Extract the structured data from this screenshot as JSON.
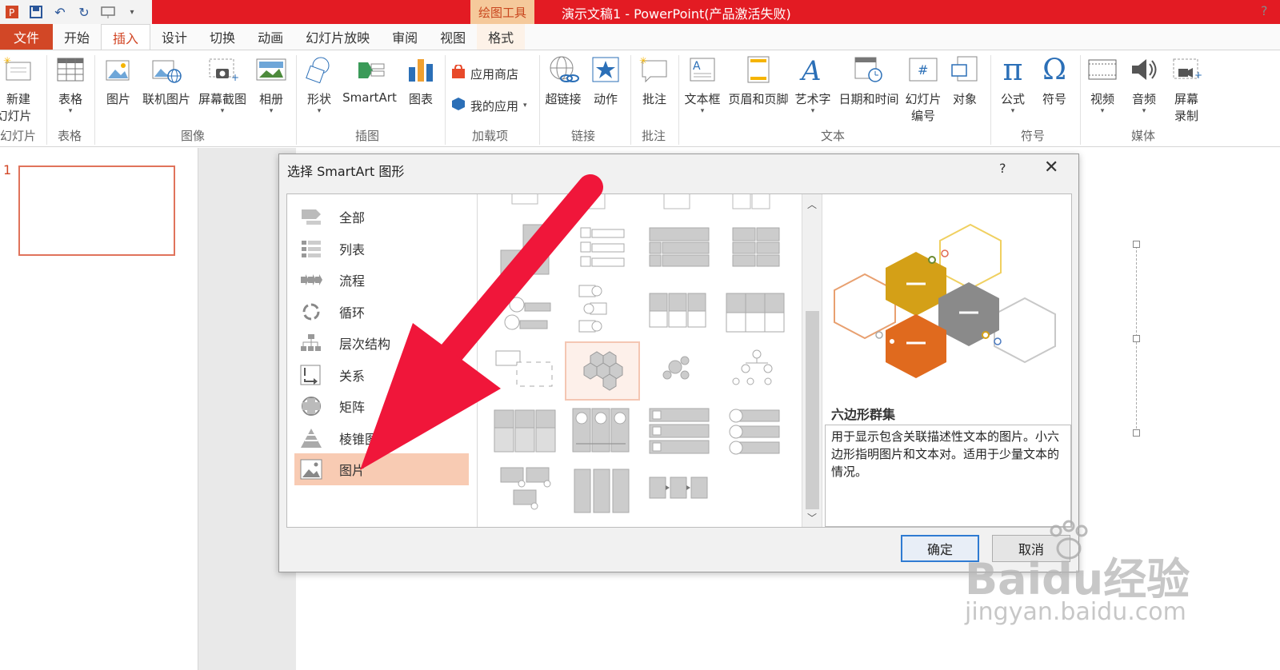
{
  "window": {
    "title": "演示文稿1 -  PowerPoint(产品激活失败)",
    "context_tab_group": "绘图工具",
    "help": "?"
  },
  "ribbon_tabs": [
    {
      "label": "文件"
    },
    {
      "label": "开始"
    },
    {
      "label": "插入"
    },
    {
      "label": "设计"
    },
    {
      "label": "切换"
    },
    {
      "label": "动画"
    },
    {
      "label": "幻灯片放映"
    },
    {
      "label": "审阅"
    },
    {
      "label": "视图"
    },
    {
      "label": "格式"
    }
  ],
  "active_tab": "插入",
  "ribbon": {
    "new_slide": "新建",
    "new_slide_line2": "幻灯片",
    "table": "表格",
    "picture": "图片",
    "online_picture": "联机图片",
    "screenshot": "屏幕截图",
    "album": "相册",
    "shapes": "形状",
    "smartart": "SmartArt",
    "chart": "图表",
    "store": "应用商店",
    "my_apps": "我的应用",
    "hyperlink": "超链接",
    "action": "动作",
    "comment": "批注",
    "textbox": "文本框",
    "header_footer": "页眉和页脚",
    "wordart": "艺术字",
    "date_time": "日期和时间",
    "slide_number": "幻灯片",
    "slide_number_line2": "编号",
    "object": "对象",
    "equation": "公式",
    "symbol": "符号",
    "video": "视频",
    "audio": "音频",
    "screen_record": "屏幕",
    "screen_record_line2": "录制",
    "groups": {
      "slides": "幻灯片",
      "tables": "表格",
      "images": "图像",
      "illustrations": "插图",
      "addins": "加载项",
      "links": "链接",
      "comments": "批注",
      "text": "文本",
      "symbols": "符号",
      "media": "媒体"
    }
  },
  "slide_panel": {
    "number": "1"
  },
  "dialog": {
    "title": "选择 SmartArt 图形",
    "help": "?",
    "categories": [
      {
        "label": "全部"
      },
      {
        "label": "列表"
      },
      {
        "label": "流程"
      },
      {
        "label": "循环"
      },
      {
        "label": "层次结构"
      },
      {
        "label": "关系"
      },
      {
        "label": "矩阵"
      },
      {
        "label": "棱锥图"
      },
      {
        "label": "图片"
      }
    ],
    "selected_category": "图片",
    "preview_name": "六边形群集",
    "preview_description": "用于显示包含关联描述性文本的图片。小六边形指明图片和文本对。适用于少量文本的情况。",
    "ok": "确定",
    "cancel": "取消"
  },
  "watermark": {
    "brand": "Baidu经验",
    "url": "jingyan.baidu.com"
  },
  "colors": {
    "title_bar": "#e31b23",
    "accent": "#d24726",
    "selected_category_bg": "#f8cbb3",
    "arrow": "#f0163a",
    "hex_gold": "#d4a017",
    "hex_gray": "#8a8a8a",
    "hex_orange": "#e06a1e"
  }
}
